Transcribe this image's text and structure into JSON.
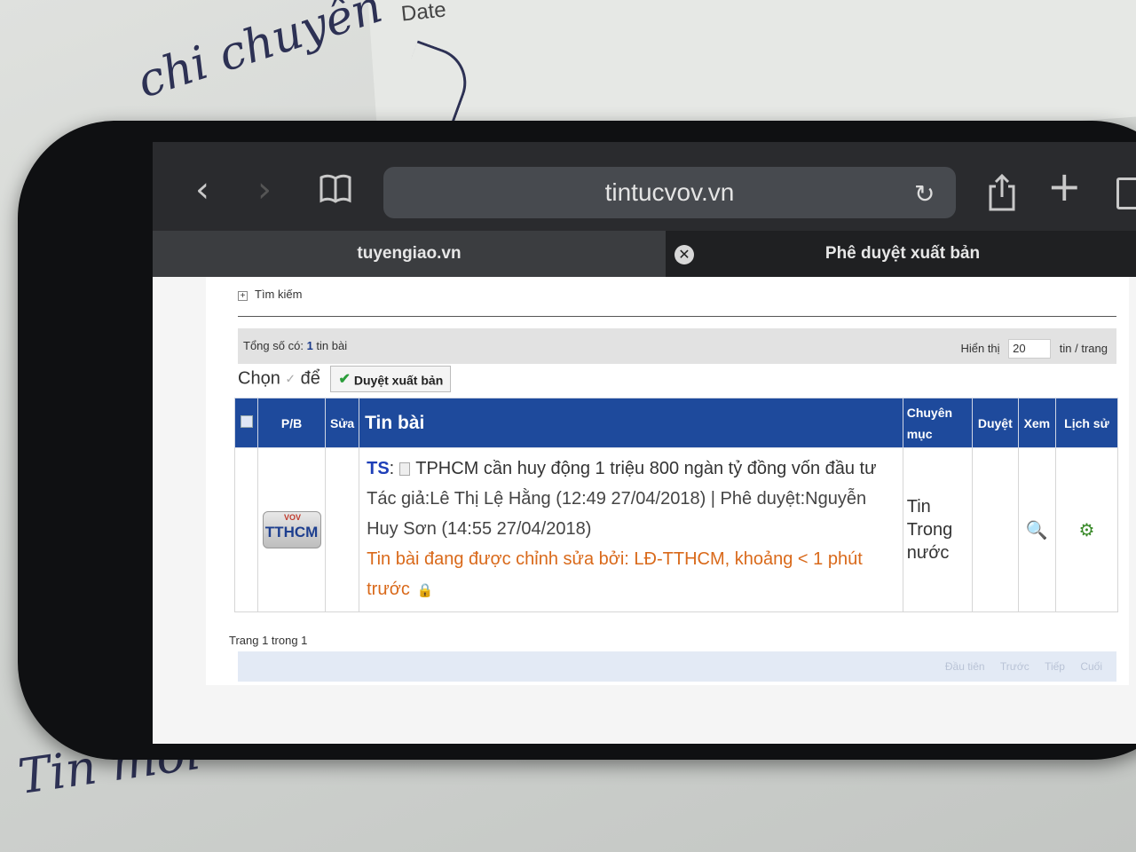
{
  "background": {
    "handwriting_top": "chi chuyên",
    "handwriting_date": "Date",
    "handwriting_bottom": "Tin mới"
  },
  "browser": {
    "url": "tintucvov.vn",
    "tabs": [
      {
        "label": "tuyengiao.vn"
      },
      {
        "label": "Phê duyệt xuất bản"
      }
    ]
  },
  "page": {
    "search_toggle": "Tìm kiếm",
    "summary_prefix": "Tổng số có:",
    "summary_count": "1",
    "summary_suffix": "tin bài",
    "display_label": "Hiển thị",
    "per_page_value": "20",
    "per_page_suffix": "tin / trang",
    "choose_label": "Chọn",
    "to_label": "để",
    "approve_button": "Duyệt xuất bản",
    "table": {
      "headers": {
        "pb": "P/B",
        "edit": "Sửa",
        "title": "Tin bài",
        "category": "Chuyên mục",
        "approve": "Duyệt",
        "view": "Xem",
        "history": "Lịch sử"
      },
      "rows": [
        {
          "logo_top": "VOV",
          "logo_text": "TTHCM",
          "ts_label": "TS",
          "title": "TPHCM cần huy động 1 triệu 800 ngàn tỷ đồng vốn đầu tư",
          "meta": "Tác giả:Lê Thị Lệ Hằng (12:49 27/04/2018) | Phê duyệt:Nguyễn Huy Sơn (14:55 27/04/2018)",
          "editing": "Tin bài đang được chỉnh sửa bởi: LĐ-TTHCM, khoảng < 1 phút trước",
          "category": "Tin Trong nước"
        }
      ]
    },
    "pager_info": "Trang 1 trong 1",
    "pager_links": [
      "Đầu tiên",
      "Trước",
      "Tiếp",
      "Cuối"
    ]
  }
}
